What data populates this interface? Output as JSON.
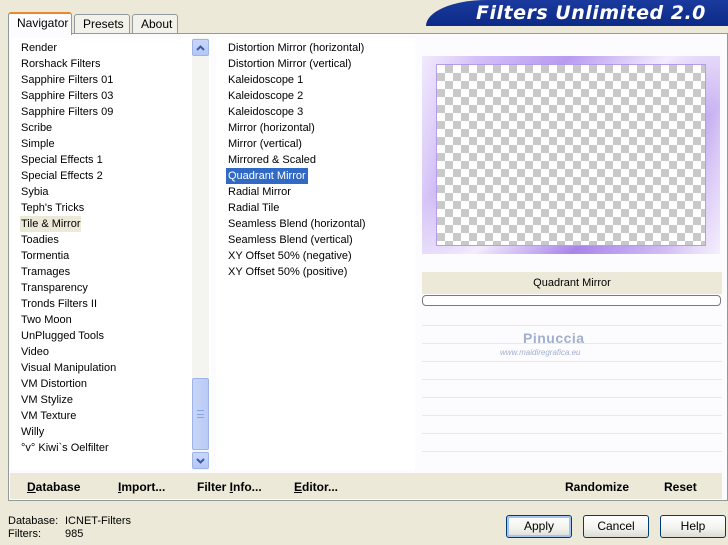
{
  "tabs": [
    {
      "label": "Navigator",
      "active": true
    },
    {
      "label": "Presets",
      "active": false
    },
    {
      "label": "About",
      "active": false
    }
  ],
  "title": "Filters Unlimited 2.0",
  "categories": [
    "Render",
    "Rorshack Filters",
    "Sapphire Filters 01",
    "Sapphire Filters 03",
    "Sapphire Filters 09",
    "Scribe",
    "Simple",
    "Special Effects 1",
    "Special Effects 2",
    "Sybia",
    "Teph's Tricks",
    "Tile & Mirror",
    "Toadies",
    "Tormentia",
    "Tramages",
    "Transparency",
    "Tronds Filters II",
    "Two Moon",
    "UnPlugged Tools",
    "Video",
    "Visual Manipulation",
    "VM Distortion",
    "VM Stylize",
    "VM Texture",
    "Willy",
    "°v° Kiwi`s Oelfilter"
  ],
  "selected_category": "Tile & Mirror",
  "filters": [
    "Distortion Mirror (horizontal)",
    "Distortion Mirror (vertical)",
    "Kaleidoscope 1",
    "Kaleidoscope 2",
    "Kaleidoscope 3",
    "Mirror (horizontal)",
    "Mirror (vertical)",
    "Mirrored & Scaled",
    "Quadrant Mirror",
    "Radial Mirror",
    "Radial Tile",
    "Seamless Blend (horizontal)",
    "Seamless Blend (vertical)",
    "XY Offset 50% (negative)",
    "XY Offset 50% (positive)"
  ],
  "selected_filter": "Quadrant Mirror",
  "preview": {
    "filter_name": "Quadrant Mirror",
    "progress": 0,
    "watermark_name": "Pinuccia",
    "watermark_url": "www.maidiregrafica.eu"
  },
  "toolbar": {
    "database": {
      "u": "D",
      "rest": "atabase"
    },
    "import": {
      "u": "I",
      "pre": "",
      "rest": "mport..."
    },
    "filter_info": {
      "pre": "Filter ",
      "u": "I",
      "rest": "nfo..."
    },
    "editor": {
      "u": "E",
      "rest": "ditor..."
    },
    "randomize": "Randomize",
    "reset": "Reset"
  },
  "status": {
    "database_label": "Database:",
    "database_value": "ICNET-Filters",
    "filters_label": "Filters:",
    "filters_value": "985"
  },
  "buttons": {
    "apply": "Apply",
    "cancel": "Cancel",
    "help": "Help"
  },
  "colors": {
    "selection": "#316ac5",
    "title_banner": "#0c2a86",
    "window_bg": "#ece9d8"
  }
}
